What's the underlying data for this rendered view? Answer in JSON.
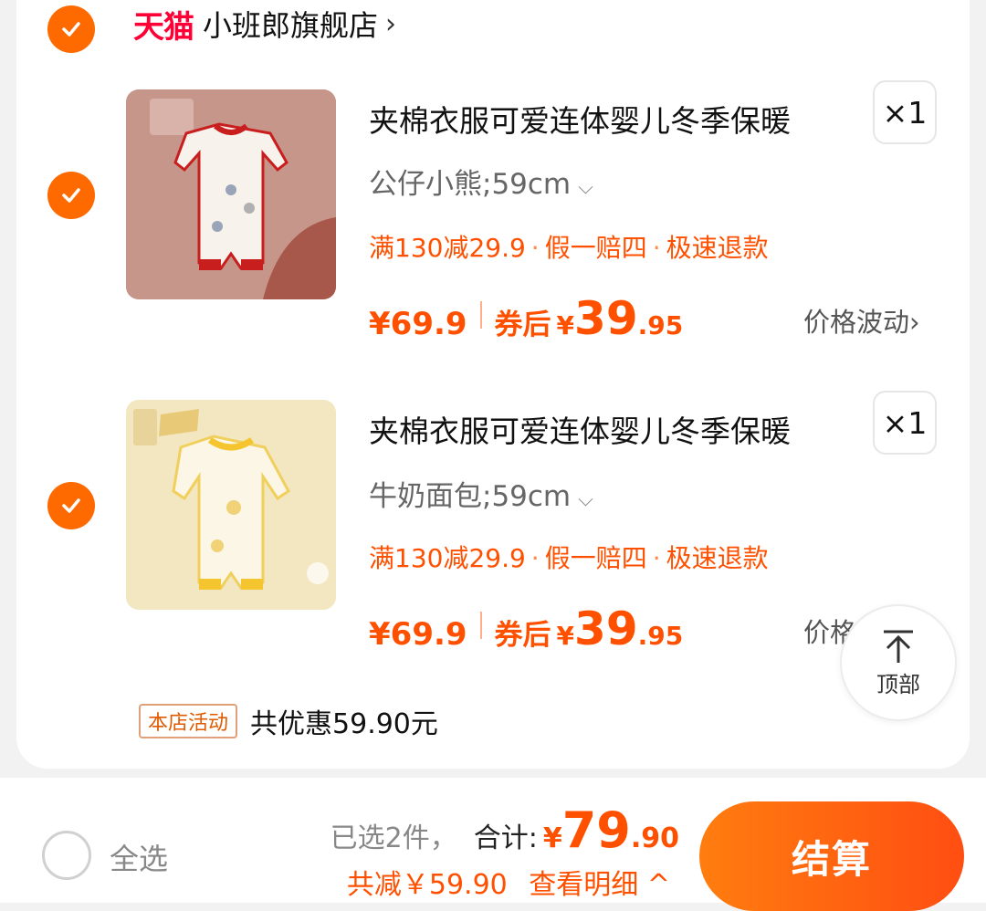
{
  "shop": {
    "logo_text": "天猫",
    "name": "小班郎旗舰店",
    "chevron": "›"
  },
  "items": [
    {
      "title": "夹棉衣服可爱连体婴儿冬季保暖",
      "sku": "公仔小熊;59cm",
      "qty": "×1",
      "promos": [
        "满130减29.9",
        "假一赔四",
        "极速退款"
      ],
      "price_original": "¥69.9",
      "coupon_label": "券后",
      "coupon_yen": "¥",
      "coupon_int": "39",
      "coupon_dec": ".95",
      "fluctuation": "价格波动",
      "fluct_chevron": "›"
    },
    {
      "title": "夹棉衣服可爱连体婴儿冬季保暖",
      "sku": "牛奶面包;59cm",
      "qty": "×1",
      "promos": [
        "满130减29.9",
        "假一赔四",
        "极速退款"
      ],
      "price_original": "¥69.9",
      "coupon_label": "券后",
      "coupon_yen": "¥",
      "coupon_int": "39",
      "coupon_dec": ".95",
      "fluctuation": "价格"
    }
  ],
  "activity": {
    "badge": "本店活动",
    "text": "共优惠59.90元"
  },
  "to_top": {
    "label": "顶部"
  },
  "bottom_bar": {
    "select_all": "全选",
    "selected_count": "已选2件，",
    "total_label": "合计:",
    "total_yen": "¥",
    "total_int": "79",
    "total_dec": ".90",
    "saved": "共减￥59.90",
    "detail": "查看明细 ^",
    "checkout": "结算"
  },
  "colors": {
    "accent": "#ff5000",
    "check": "#ff6a00",
    "tmall": "#ff0036"
  }
}
